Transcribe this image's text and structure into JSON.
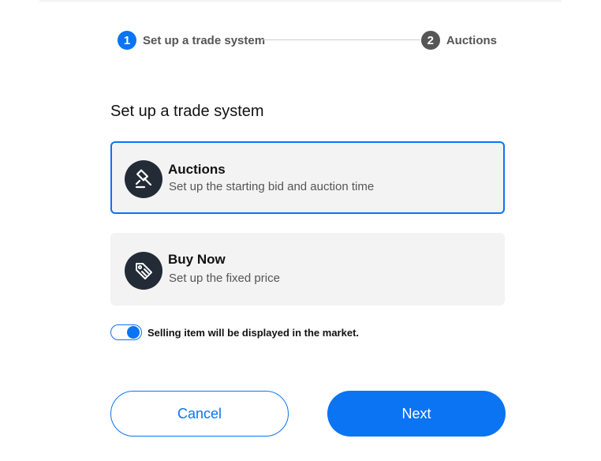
{
  "stepper": {
    "steps": [
      {
        "number": "1",
        "label": "Set up a trade system"
      },
      {
        "number": "2",
        "label": "Auctions"
      }
    ]
  },
  "page_title": "Set up a trade system",
  "options": [
    {
      "title": "Auctions",
      "description": "Set up the starting bid and auction time",
      "icon": "gavel-icon",
      "selected": true
    },
    {
      "title": "Buy Now",
      "description": "Set up the fixed price",
      "icon": "price-tag-icon",
      "selected": false
    }
  ],
  "market_toggle": {
    "label": "Selling item will be displayed in the market.",
    "on": true
  },
  "buttons": {
    "cancel": "Cancel",
    "next": "Next"
  },
  "colors": {
    "accent": "#0a74f2",
    "icon_bg": "#222b36",
    "card_bg": "#f3f3f3",
    "step_inactive": "#565656"
  }
}
